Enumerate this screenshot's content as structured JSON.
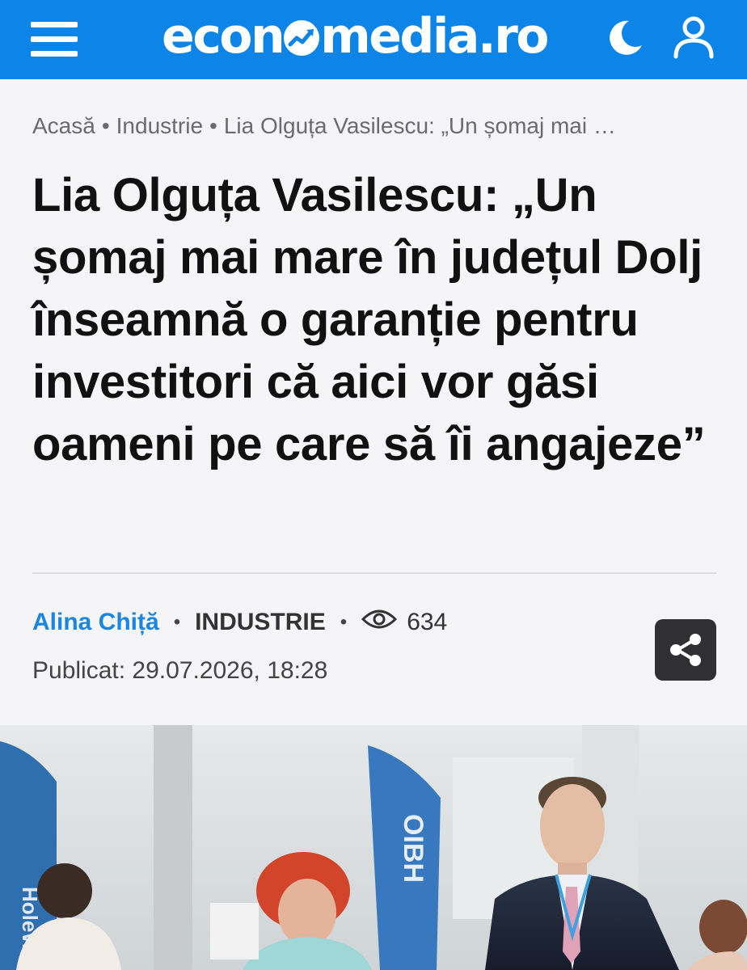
{
  "header": {
    "logo_left": "econ",
    "logo_right": "media.ro",
    "menu_icon": "hamburger-menu-icon",
    "theme_icon": "moon-icon",
    "account_icon": "user-icon",
    "brand_color": "#0d84e8"
  },
  "breadcrumb": {
    "items": [
      "Acasă",
      "Industrie",
      "Lia Olguța Vasilescu: „Un șomaj mai …"
    ]
  },
  "article": {
    "title": "Lia Olguța Vasilescu: „Un șomaj mai mare în județul Dolj înseamnă o garanție pentru investitori că aici vor găsi oameni pe care să îi angajeze”",
    "author": "Alina Chiță",
    "category": "INDUSTRIE",
    "views": "634",
    "published": "Publicat: 29.07.2026, 18:28",
    "share_icon": "share-icon",
    "author_color": "#1a86e0"
  },
  "photo": {
    "banner_left_text": "HoleWorld",
    "banner_mid_text": "OIBH"
  }
}
